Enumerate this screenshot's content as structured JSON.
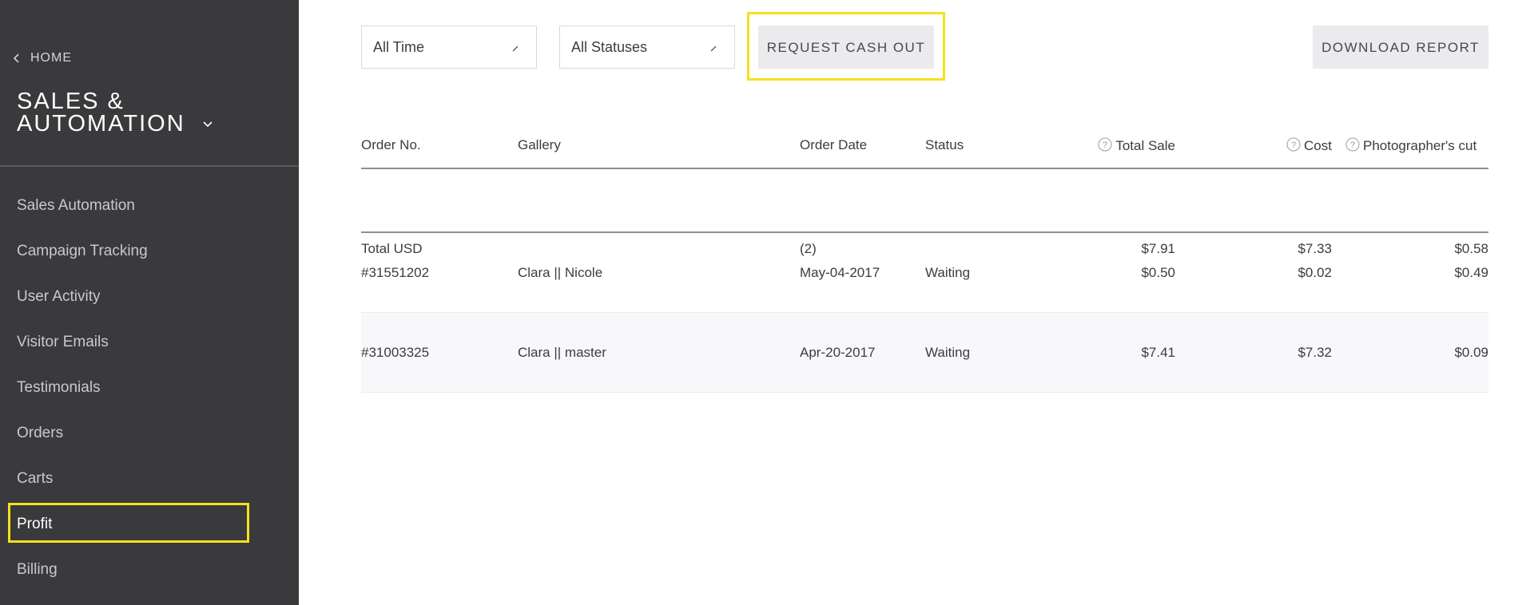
{
  "sidebar": {
    "home_label": "HOME",
    "title_line1": "SALES &",
    "title_line2": "AUTOMATION",
    "items": [
      {
        "label": "Sales Automation"
      },
      {
        "label": "Campaign Tracking"
      },
      {
        "label": "User Activity"
      },
      {
        "label": "Visitor Emails"
      },
      {
        "label": "Testimonials"
      },
      {
        "label": "Orders"
      },
      {
        "label": "Carts"
      },
      {
        "label": "Profit"
      },
      {
        "label": "Billing"
      }
    ],
    "active_item": "Profit"
  },
  "filters": {
    "time": "All Time",
    "status": "All Statuses"
  },
  "buttons": {
    "cashout": "REQUEST CASH OUT",
    "download": "DOWNLOAD REPORT"
  },
  "table": {
    "headers": {
      "order_no": "Order No.",
      "gallery": "Gallery",
      "order_date": "Order Date",
      "status": "Status",
      "total_sale": "Total Sale",
      "cost": "Cost",
      "photographer_cut": "Photographer's cut"
    },
    "summary": {
      "label": "Total USD",
      "count": "(2)",
      "total_sale": "$7.91",
      "cost": "$7.33",
      "photographer_cut": "$0.58"
    },
    "rows": [
      {
        "order_no": "#31551202",
        "gallery": "Clara || Nicole",
        "order_date": "May-04-2017",
        "status": "Waiting",
        "total_sale": "$0.50",
        "cost": "$0.02",
        "photographer_cut": "$0.49"
      },
      {
        "order_no": "#31003325",
        "gallery": "Clara || master",
        "order_date": "Apr-20-2017",
        "status": "Waiting",
        "total_sale": "$7.41",
        "cost": "$7.32",
        "photographer_cut": "$0.09"
      }
    ]
  },
  "colors": {
    "sidebar_bg": "#3a393c",
    "highlight": "#f5e11d",
    "button_bg": "#ebeaec"
  }
}
